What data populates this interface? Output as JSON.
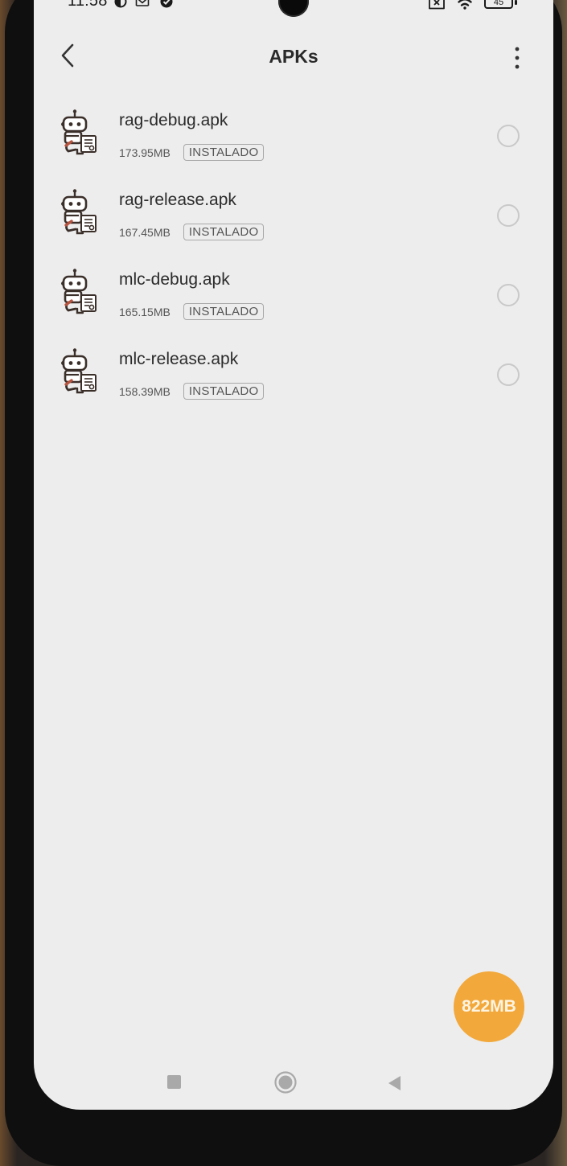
{
  "status_bar": {
    "time": "11:58",
    "battery_level": "45",
    "icons": [
      "data-saver-icon",
      "gmail-icon",
      "check-circle-icon",
      "no-sim-icon",
      "wifi-icon",
      "battery-icon"
    ]
  },
  "header": {
    "title": "APKs",
    "back_icon": "chevron-left-icon",
    "menu_icon": "more-vertical-icon"
  },
  "apks": [
    {
      "name": "rag-debug.apk",
      "size": "173.95MB",
      "status": "INSTALADO",
      "selected": false
    },
    {
      "name": "rag-release.apk",
      "size": "167.45MB",
      "status": "INSTALADO",
      "selected": false
    },
    {
      "name": "mlc-debug.apk",
      "size": "165.15MB",
      "status": "INSTALADO",
      "selected": false
    },
    {
      "name": "mlc-release.apk",
      "size": "158.39MB",
      "status": "INSTALADO",
      "selected": false
    }
  ],
  "fab": {
    "label": "822MB"
  },
  "nav_bar": {
    "items": [
      "recents-icon",
      "home-icon",
      "back-icon"
    ]
  },
  "colors": {
    "screen_background": "#ededed",
    "fab": "#f2a83a",
    "text_primary": "#2b2b2b",
    "badge_border": "#a8a8a8"
  }
}
